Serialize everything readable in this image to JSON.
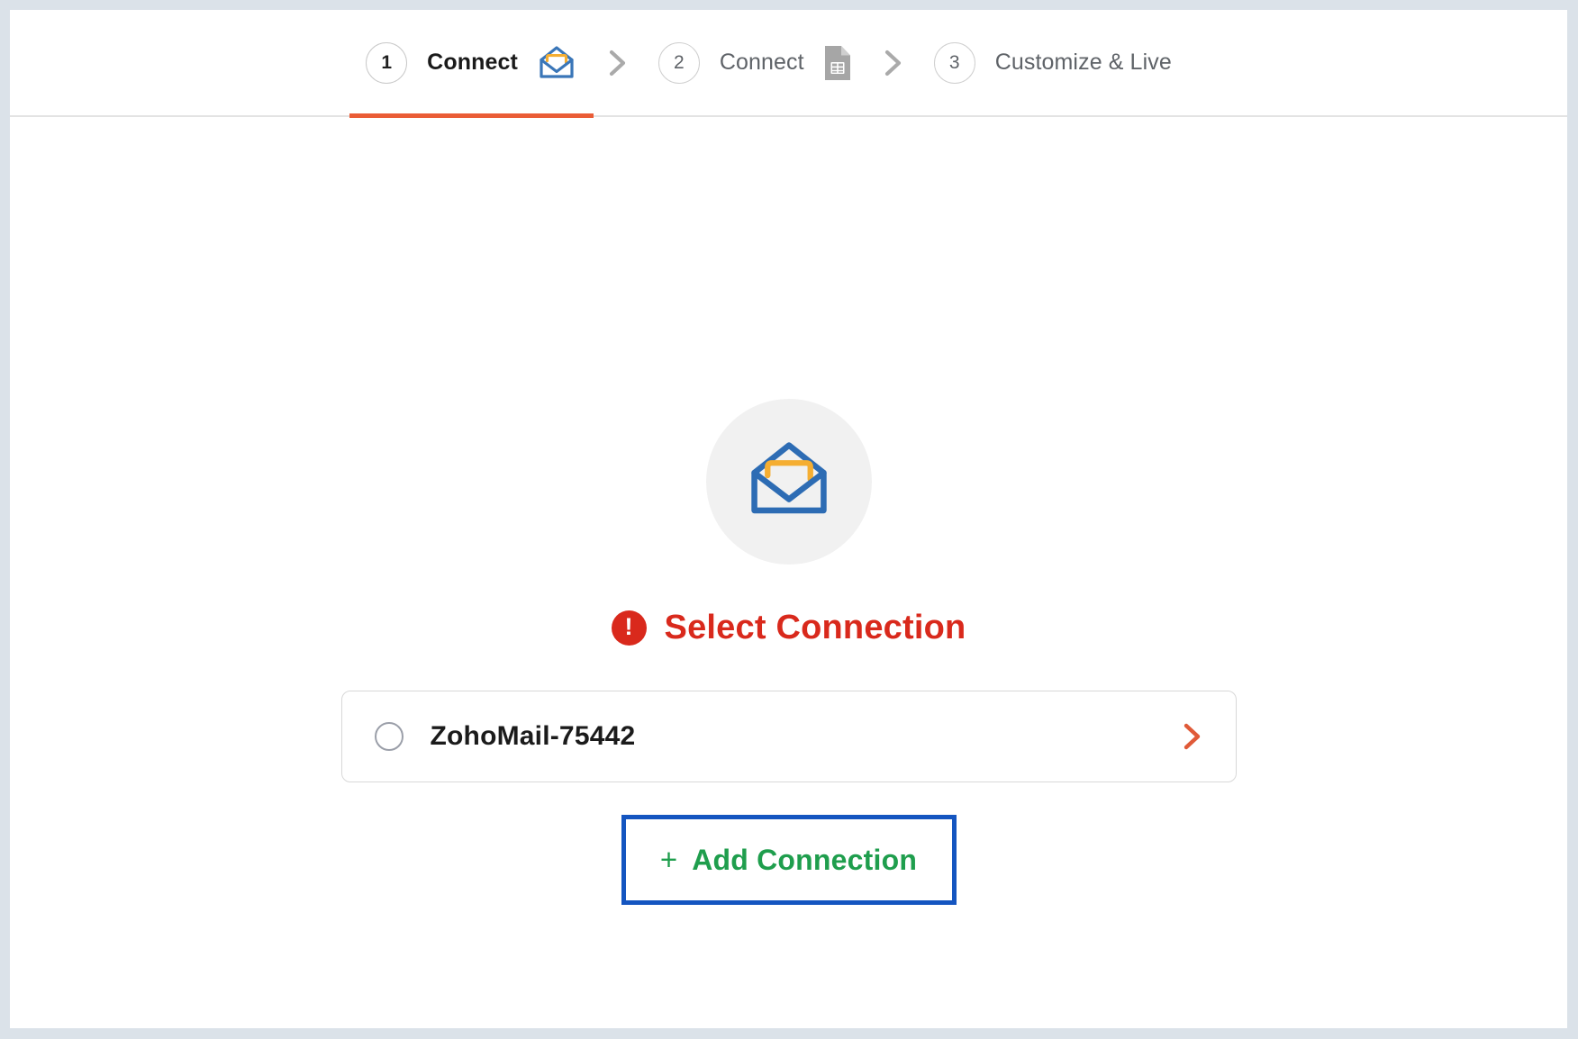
{
  "window": {
    "frame_color": "#dbe2e9",
    "background": "#ffffff"
  },
  "stepper": {
    "active_underline_color": "#ea5c36",
    "steps": [
      {
        "number": "1",
        "label": "Connect",
        "icon": "zoho-mail-envelope-icon",
        "state": "active"
      },
      {
        "number": "2",
        "label": "Connect",
        "icon": "google-sheets-document-icon",
        "state": "inactive"
      },
      {
        "number": "3",
        "label": "Customize & Live",
        "icon": "none",
        "state": "inactive"
      }
    ],
    "separator": "chevron-right-icon"
  },
  "main": {
    "brand_icon": "zoho-mail-envelope-icon",
    "brand_icon_bg": "#f1f1f1",
    "alert_icon": "exclamation-circle-icon",
    "alert_color": "#d9291c",
    "headline": "Select Connection",
    "connections": [
      {
        "name": "ZohoMail-75442",
        "selected": false,
        "chevron": "chevron-right-icon",
        "chevron_color": "#e05a38"
      }
    ],
    "add_button": {
      "plus": "+",
      "label": "Add Connection",
      "text_color": "#1f9e4d",
      "focus_border_color": "#1455c0"
    }
  }
}
